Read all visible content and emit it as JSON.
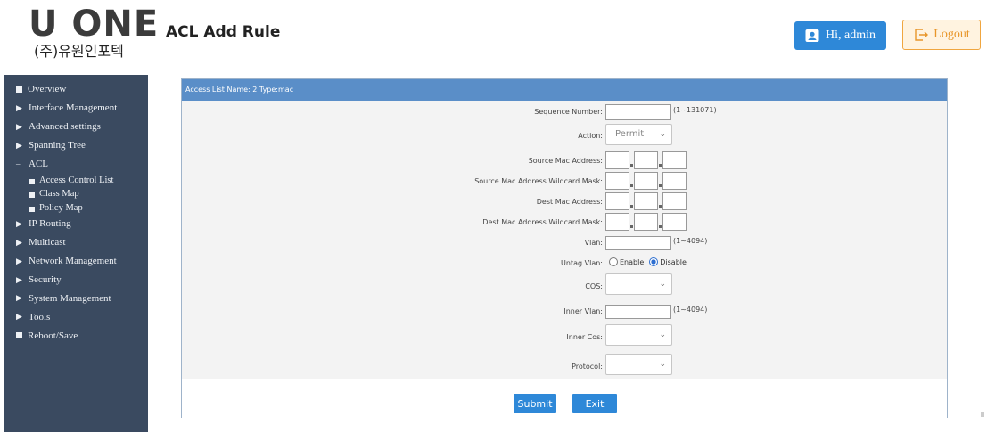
{
  "header": {
    "logo_main": "U ONE",
    "logo_sub": "(주)유원인포텍",
    "title": "ACL Add Rule",
    "user_label": "Hi, admin",
    "logout_label": "Logout"
  },
  "sidebar": {
    "items": [
      {
        "label": "Overview",
        "marker": "square"
      },
      {
        "label": "Interface Management",
        "marker": "arrow"
      },
      {
        "label": "Advanced settings",
        "marker": "arrow"
      },
      {
        "label": "Spanning Tree",
        "marker": "arrow"
      },
      {
        "label": "ACL",
        "marker": "dash"
      },
      {
        "label": "IP Routing",
        "marker": "arrow"
      },
      {
        "label": "Multicast",
        "marker": "arrow"
      },
      {
        "label": "Network Management",
        "marker": "arrow"
      },
      {
        "label": "Security",
        "marker": "arrow"
      },
      {
        "label": "System Management",
        "marker": "arrow"
      },
      {
        "label": "Tools",
        "marker": "arrow"
      },
      {
        "label": "Reboot/Save",
        "marker": "square"
      }
    ],
    "acl_sub": [
      "Access Control List",
      "Class Map",
      "Policy Map"
    ]
  },
  "panel": {
    "heading": "Access List Name: 2 Type:mac",
    "fields": {
      "sequence_label": "Sequence Number:",
      "sequence_value": "",
      "sequence_hint": "(1~131071)",
      "action_label": "Action:",
      "action_value": "Permit",
      "src_mac_label": "Source Mac Address:",
      "src_mask_label": "Source Mac Address Wildcard Mask:",
      "dst_mac_label": "Dest Mac Address:",
      "dst_mask_label": "Dest Mac Address Wildcard Mask:",
      "vlan_label": "Vlan:",
      "vlan_value": "",
      "vlan_hint": "(1~4094)",
      "untag_label": "Untag Vlan:",
      "untag_enable": "Enable",
      "untag_disable": "Disable",
      "untag_selected": "Disable",
      "cos_label": "COS:",
      "cos_value": "",
      "inner_vlan_label": "Inner Vlan:",
      "inner_vlan_value": "",
      "inner_vlan_hint": "(1~4094)",
      "inner_cos_label": "Inner Cos:",
      "inner_cos_value": "",
      "protocol_label": "Protocol:",
      "protocol_value": ""
    },
    "submit_label": "Submit",
    "exit_label": "Exit"
  },
  "colors": {
    "sidebar_bg": "#3a4a60",
    "panel_head_bg": "#5a8ec8",
    "button_blue": "#2e88d8",
    "logout_orange": "#e8962a"
  }
}
